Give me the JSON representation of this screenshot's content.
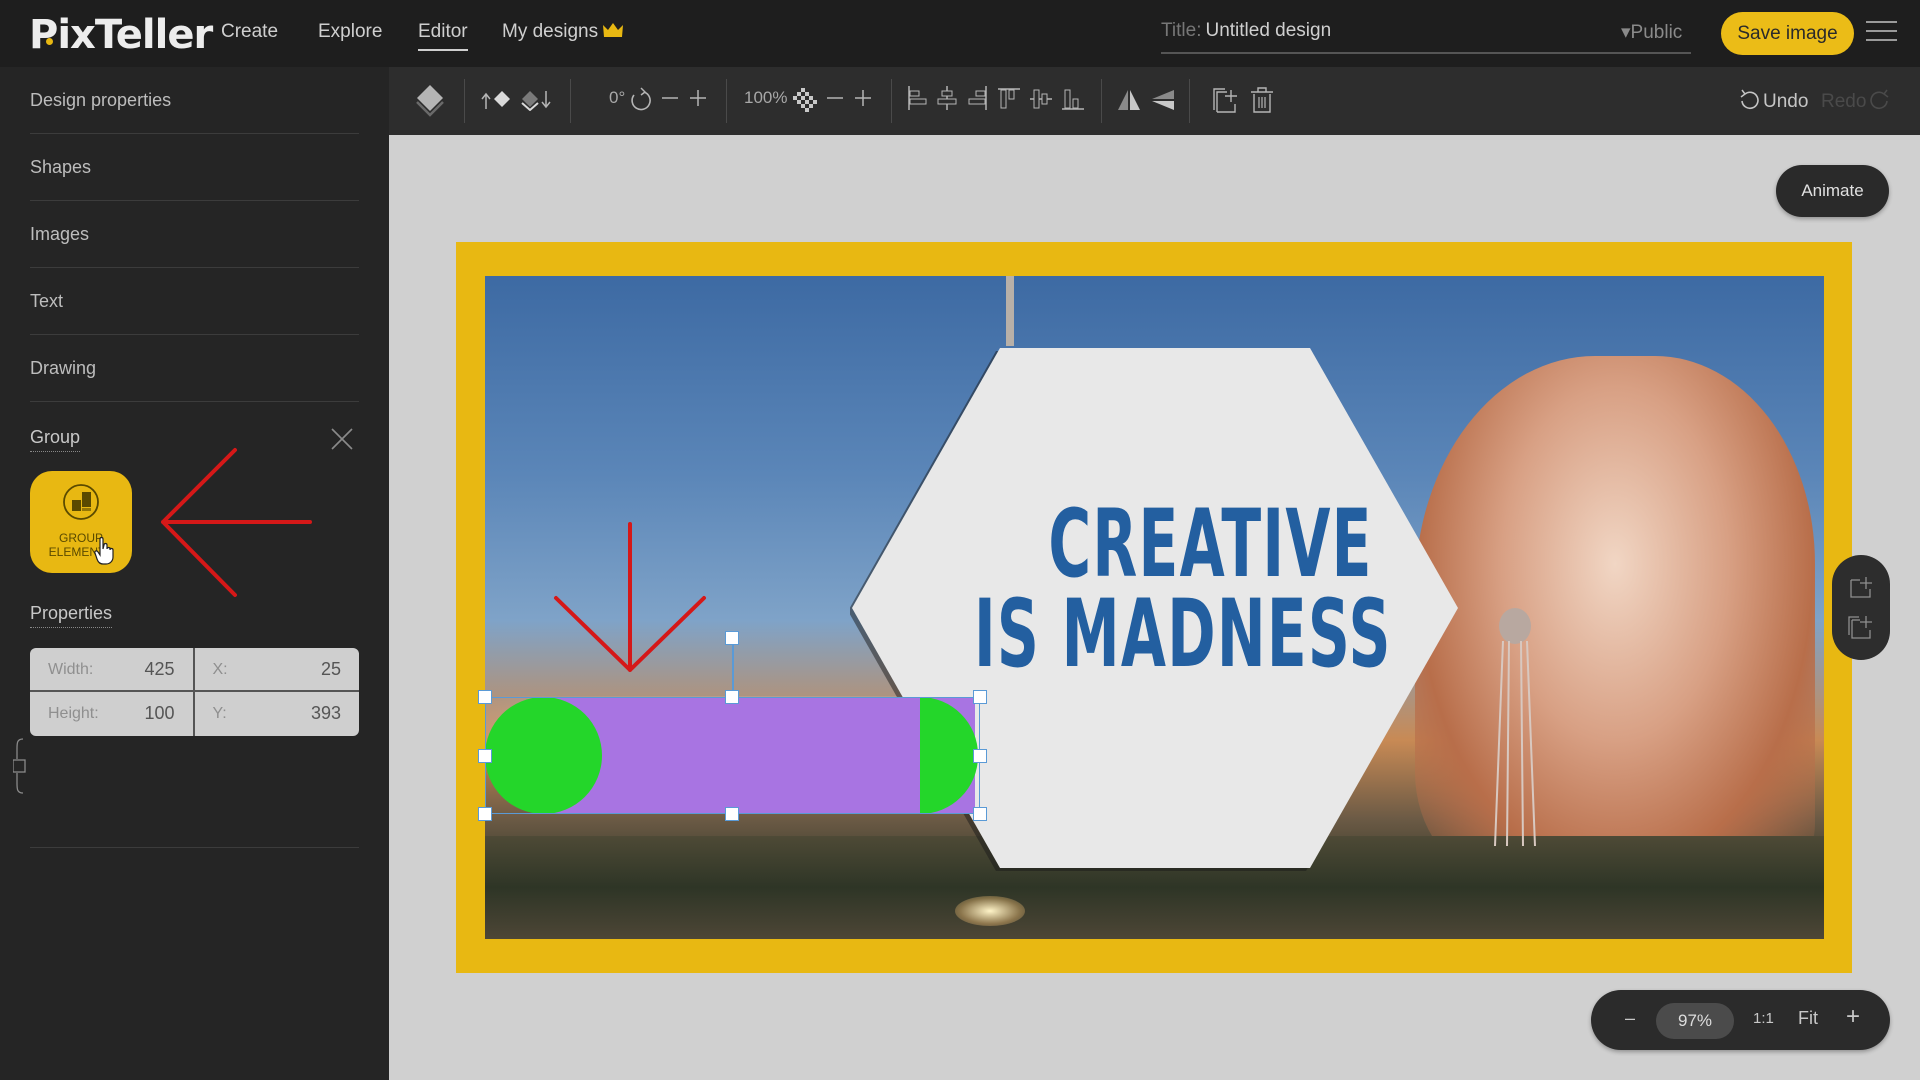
{
  "app": {
    "logo": "PixTeller",
    "nav": [
      {
        "label": "Create",
        "active": false
      },
      {
        "label": "Explore",
        "active": false
      },
      {
        "label": "Editor",
        "active": true
      },
      {
        "label": "My designs",
        "active": false,
        "icon": "crown-icon"
      }
    ],
    "title_label": "Title:",
    "title_value": "Untitled design",
    "visibility": "▾Public",
    "save_label": "Save image",
    "accent_color": "#e8b812"
  },
  "sidebar": {
    "items": [
      {
        "label": "Design properties"
      },
      {
        "label": "Shapes"
      },
      {
        "label": "Images"
      },
      {
        "label": "Text"
      },
      {
        "label": "Drawing"
      }
    ],
    "group": {
      "title": "Group",
      "button_label_line1": "GROUP",
      "button_label_line2": "ELEMENTS"
    },
    "properties": {
      "title": "Properties",
      "width_label": "Width:",
      "width_value": "425",
      "height_label": "Height:",
      "height_value": "100",
      "x_label": "X:",
      "x_value": "25",
      "y_label": "Y:",
      "y_value": "393"
    }
  },
  "toolbar": {
    "rotation": "0°",
    "opacity": "100%",
    "undo_label": "Undo",
    "redo_label": "Redo"
  },
  "workspace": {
    "animate_label": "Animate",
    "zoom": {
      "minus": "–",
      "value": "97%",
      "one_to_one": "1:1",
      "fit": "Fit",
      "plus": "+"
    }
  },
  "canvas": {
    "headline_line1": "CREATIVE",
    "headline_line2": "IS MADNESS",
    "frame_color": "#e8b812",
    "text_color": "#235fa0",
    "shape_purple": "#a874e2",
    "shape_green": "#24d62a"
  }
}
